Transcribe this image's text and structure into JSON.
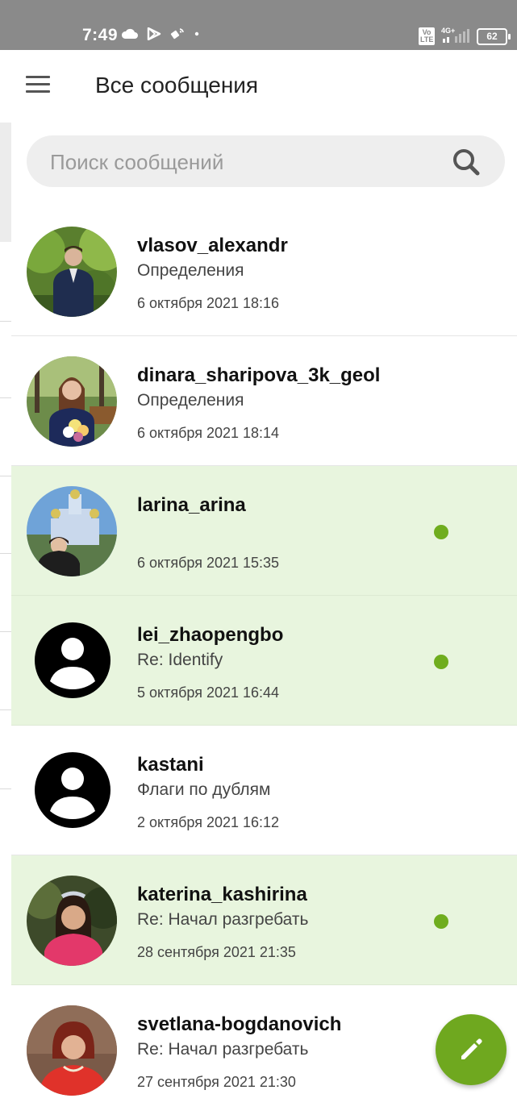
{
  "status_bar": {
    "time": "7:49",
    "network_label": "4G+",
    "volte_label": "Vo LTE",
    "battery": "62"
  },
  "header": {
    "title": "Все сообщения"
  },
  "search": {
    "placeholder": "Поиск сообщений"
  },
  "messages": [
    {
      "sender": "vlasov_alexandr",
      "subject": "Определения",
      "date": "6 октября 2021 18:16",
      "unread": false,
      "avatar": "photo"
    },
    {
      "sender": "dinara_sharipova_3k_geol",
      "subject": "Определения",
      "date": "6 октября 2021 18:14",
      "unread": false,
      "avatar": "photo"
    },
    {
      "sender": "larina_arina",
      "subject": "",
      "date": "6 октября 2021 15:35",
      "unread": true,
      "avatar": "photo"
    },
    {
      "sender": "lei_zhaopengbo",
      "subject": "Re: Identify",
      "date": "5 октября 2021 16:44",
      "unread": true,
      "avatar": "default"
    },
    {
      "sender": "kastani",
      "subject": "Флаги по дублям",
      "date": "2 октября 2021 16:12",
      "unread": false,
      "avatar": "default"
    },
    {
      "sender": "katerina_kashirina",
      "subject": "Re: Начал разгребать",
      "date": "28 сентября 2021 21:35",
      "unread": true,
      "avatar": "photo"
    },
    {
      "sender": "svetlana-bogdanovich",
      "subject": "Re: Начал разгребать",
      "date": "27 сентября 2021 21:30",
      "unread": false,
      "avatar": "photo"
    }
  ],
  "colors": {
    "accent": "#6fa81f",
    "unread_background": "#e8f5de",
    "unread_dot": "#6fad1e",
    "status_bar": "#8a8a8a"
  },
  "icons": {
    "menu": "hamburger-menu-icon",
    "search": "search-icon",
    "compose": "pencil-icon"
  }
}
